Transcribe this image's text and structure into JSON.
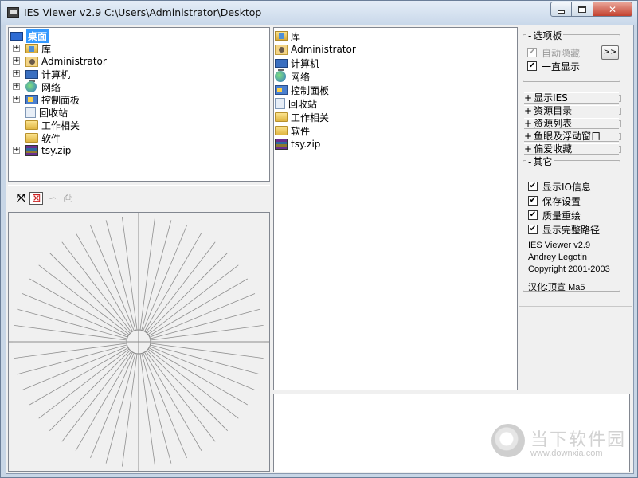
{
  "window": {
    "title": "IES Viewer v2.9",
    "path": "C:\\Users\\Administrator\\Desktop",
    "close_glyph": "✕"
  },
  "tree": {
    "root": {
      "label": "桌面",
      "icon": "desktop-icon"
    },
    "items": [
      {
        "label": "库",
        "icon": "library-icon",
        "expandable": true
      },
      {
        "label": "Administrator",
        "icon": "user-folder-icon",
        "expandable": true
      },
      {
        "label": "计算机",
        "icon": "computer-icon",
        "expandable": true
      },
      {
        "label": "网络",
        "icon": "network-icon",
        "expandable": true
      },
      {
        "label": "控制面板",
        "icon": "control-panel-icon",
        "expandable": true
      },
      {
        "label": "回收站",
        "icon": "recycle-bin-icon",
        "expandable": false
      },
      {
        "label": "工作相关",
        "icon": "folder-icon",
        "expandable": false
      },
      {
        "label": "软件",
        "icon": "folder-icon",
        "expandable": false
      },
      {
        "label": "tsy.zip",
        "icon": "zip-archive-icon",
        "expandable": true
      }
    ],
    "expander_glyph": "+"
  },
  "files": {
    "items": [
      {
        "label": "库",
        "icon": "library-icon"
      },
      {
        "label": "Administrator",
        "icon": "user-folder-icon"
      },
      {
        "label": "计算机",
        "icon": "computer-icon"
      },
      {
        "label": "网络",
        "icon": "network-icon"
      },
      {
        "label": "控制面板",
        "icon": "control-panel-icon"
      },
      {
        "label": "回收站",
        "icon": "recycle-bin-icon"
      },
      {
        "label": "工作相关",
        "icon": "folder-icon"
      },
      {
        "label": "软件",
        "icon": "folder-icon"
      },
      {
        "label": "tsy.zip",
        "icon": "zip-archive-icon"
      }
    ]
  },
  "toolbar": {
    "icons": [
      "fit-view-icon",
      "3d-view-icon",
      "cone-view-icon",
      "print-icon"
    ],
    "fit_glyph": "⤧",
    "view3d_glyph": "⊠",
    "cone_glyph": "∽",
    "print_glyph": "⎙"
  },
  "sidebar": {
    "options_title": "选项板",
    "auto_hide": {
      "label": "自动隐藏",
      "checked": true,
      "disabled": true
    },
    "always_show": {
      "label": "一直显示",
      "checked": true
    },
    "expand_button": ">>",
    "sections": [
      "显示IES",
      "资源目录",
      "资源列表",
      "鱼眼及浮动窗口",
      "偏爱收藏"
    ],
    "other_title": "其它",
    "other_checks": [
      {
        "label": "显示IO信息",
        "checked": true
      },
      {
        "label": "保存设置",
        "checked": true
      },
      {
        "label": "质量重绘",
        "checked": true
      },
      {
        "label": "显示完整路径",
        "checked": true
      }
    ],
    "check_glyph": "✔",
    "about": [
      "IES Viewer v2.9",
      "Andrey Legotin",
      "Copyright 2001-2003"
    ],
    "localization": "汉化:顶宣 Ma5"
  },
  "watermark": {
    "text": "当下软件园",
    "url": "www.downxia.com"
  },
  "colors": {
    "selection": "#3399ff",
    "titlebar": "#c9d8ea",
    "client_bg": "#f0f0f0",
    "close_button": "#c3402e"
  }
}
